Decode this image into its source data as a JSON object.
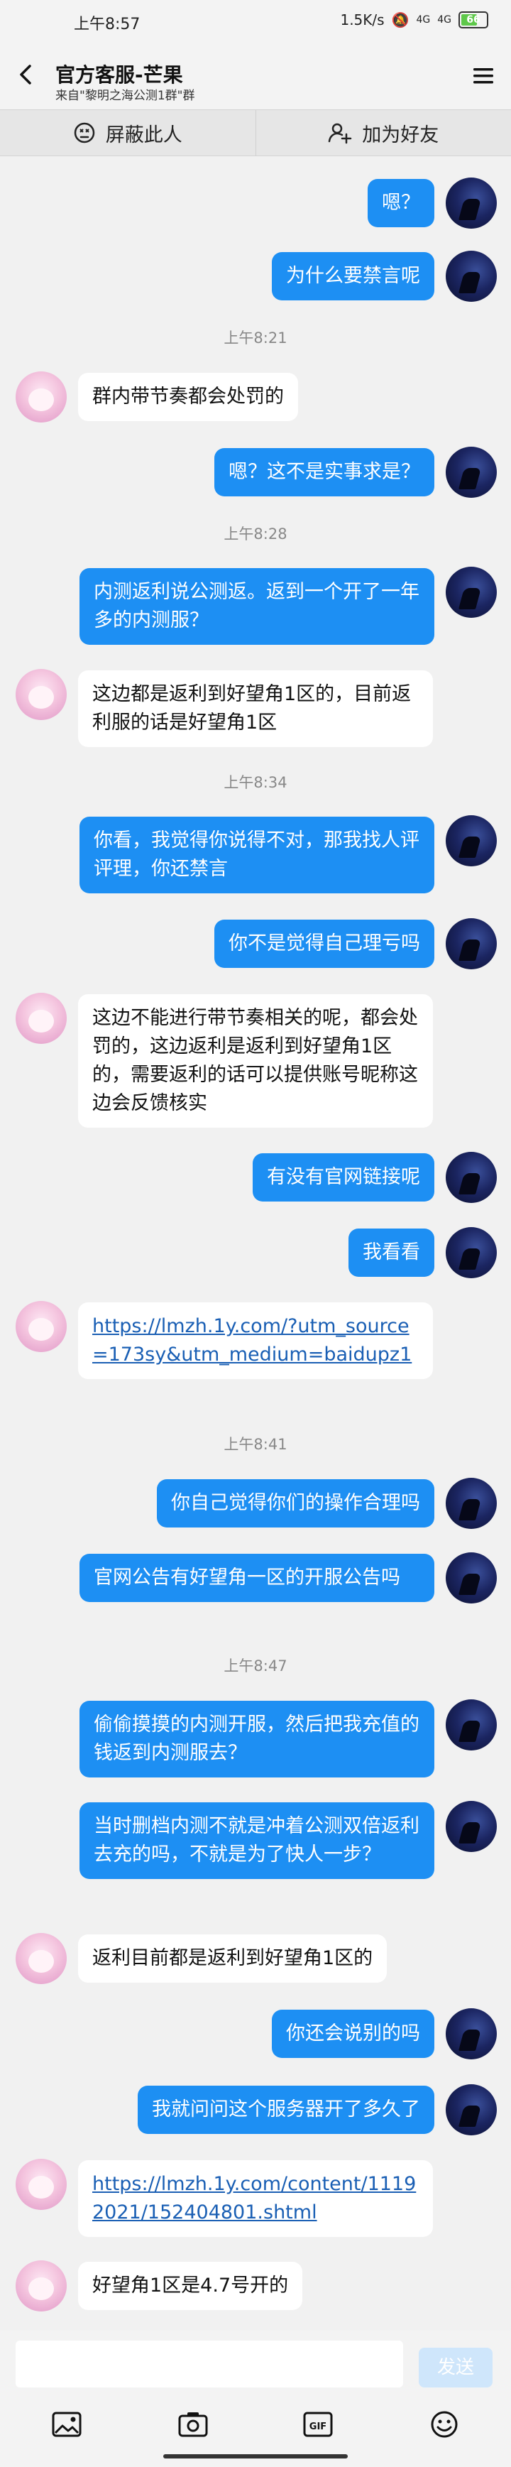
{
  "status_bar": {
    "time": "上午8:57",
    "network_speed": "1.5K/s",
    "signal1": "4G",
    "signal2": "4G",
    "battery": "66"
  },
  "header": {
    "title": "官方客服-芒果",
    "subtitle": "来自\"黎明之海公测1群\"群"
  },
  "actions": {
    "block_label": "屏蔽此人",
    "add_friend_label": "加为好友"
  },
  "messages": [
    {
      "type": "me",
      "text": "嗯？"
    },
    {
      "type": "me",
      "text": "为什么要禁言呢"
    },
    {
      "type": "time",
      "text": "上午8:21"
    },
    {
      "type": "them",
      "text": "群内带节奏都会处罚的"
    },
    {
      "type": "me",
      "text": "嗯？这不是实事求是？"
    },
    {
      "type": "time",
      "text": "上午8:28"
    },
    {
      "type": "me",
      "text": "内测返利说公测返。返到一个开了一年多的内测服？"
    },
    {
      "type": "them",
      "text": "这边都是返利到好望角1区的，目前返利服的话是好望角1区"
    },
    {
      "type": "time",
      "text": "上午8:34"
    },
    {
      "type": "me",
      "text": "你看，我觉得你说得不对，那我找人评评理，你还禁言"
    },
    {
      "type": "me",
      "text": "你不是觉得自己理亏吗"
    },
    {
      "type": "them",
      "text": "这边不能进行带节奏相关的呢，都会处罚的，这边返利是返利到好望角1区的，需要返利的话可以提供账号昵称这边会反馈核实"
    },
    {
      "type": "me",
      "text": "有没有官网链接呢"
    },
    {
      "type": "me",
      "text": "我看看"
    },
    {
      "type": "them",
      "text": "https://lmzh.1y.com/?utm_source=173sy&utm_medium=baidupz1",
      "link": true
    },
    {
      "type": "time",
      "text": "上午8:41"
    },
    {
      "type": "me",
      "text": "你自己觉得你们的操作合理吗"
    },
    {
      "type": "me",
      "text": "官网公告有好望角一区的开服公告吗"
    },
    {
      "type": "time",
      "text": "上午8:47"
    },
    {
      "type": "me",
      "text": "偷偷摸摸的内测开服，然后把我充值的钱返到内测服去？"
    },
    {
      "type": "me",
      "text": "当时删档内测不就是冲着公测双倍返利去充的吗，不就是为了快人一步？"
    },
    {
      "type": "them",
      "text": "返利目前都是返利到好望角1区的"
    },
    {
      "type": "me",
      "text": "你还会说别的吗"
    },
    {
      "type": "me",
      "text": "我就问问这个服务器开了多久了"
    },
    {
      "type": "them",
      "text": "https://lmzh.1y.com/content/11192021/152404801.shtml",
      "link": true
    },
    {
      "type": "them",
      "text": "好望角1区是4.7号开的"
    }
  ],
  "composer": {
    "input_value": "",
    "send_label": "发送"
  },
  "toolbar": {
    "icons": [
      "image-icon",
      "camera-icon",
      "gif-icon",
      "emoji-icon"
    ],
    "gif_label": "GIF"
  },
  "colors": {
    "my_bubble": "#1d8ff3",
    "their_bubble": "#ffffff",
    "background": "#f1f1f1",
    "link": "#1a5fb4"
  }
}
